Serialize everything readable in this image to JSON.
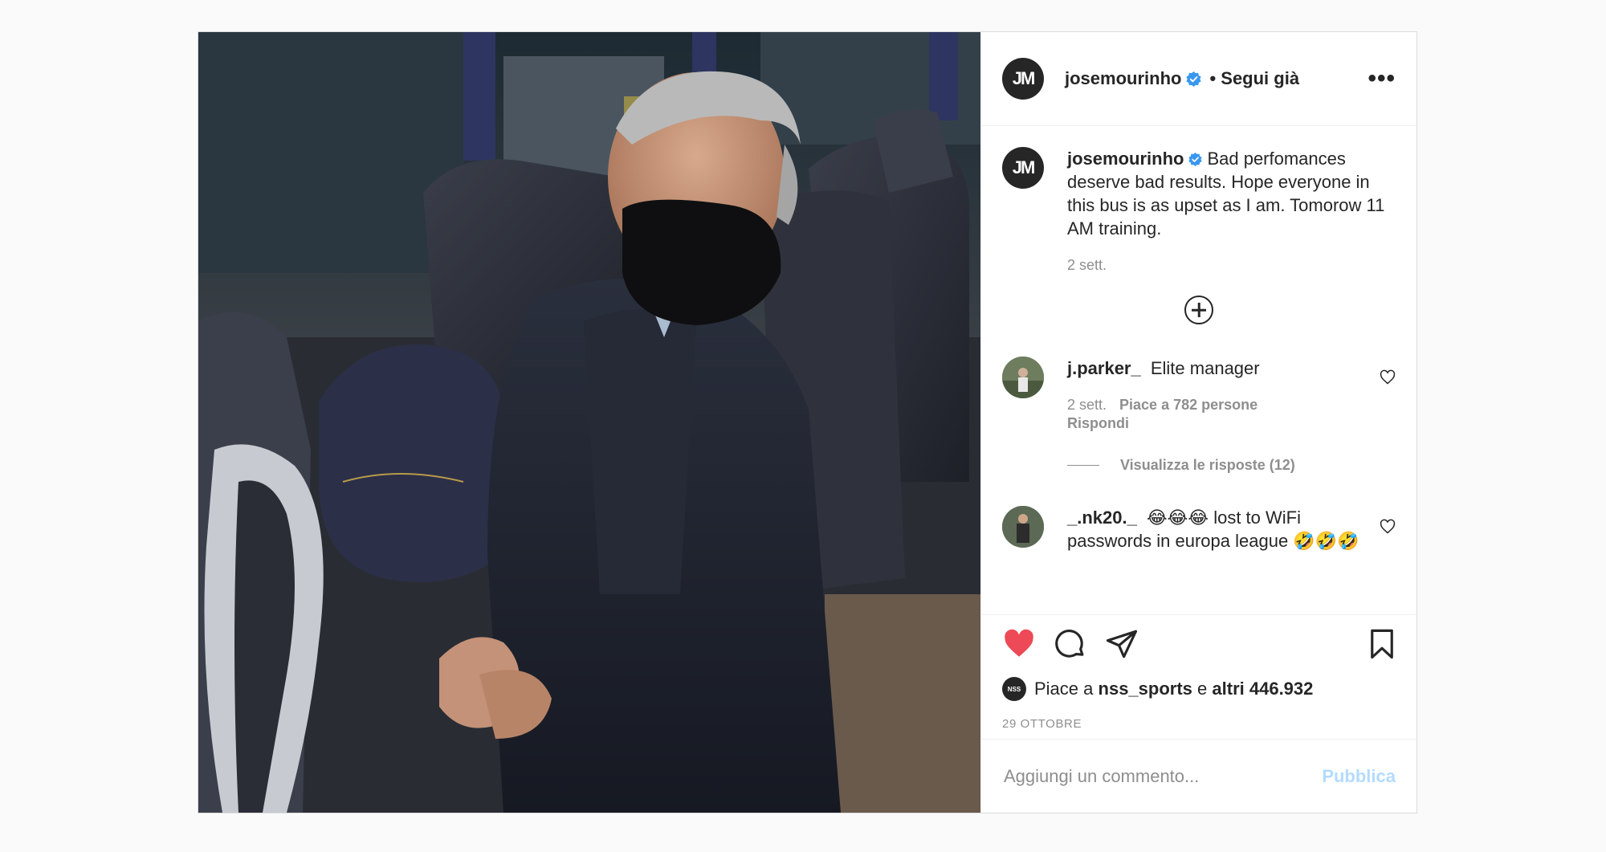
{
  "post": {
    "username": "josemourinho",
    "follow_status": "• Segui già",
    "more_label": "•••",
    "avatar_mark": "JM",
    "image_alt": "Man wearing a black face mask seated on a bus",
    "caption": {
      "username": "josemourinho",
      "text": "Bad perfomances deserve bad results. Hope everyone in this bus is as upset as I am. Tomorow 11 AM training.",
      "time": "2 sett."
    },
    "comments": [
      {
        "username": "j.parker_",
        "text": "Elite manager",
        "time": "2 sett.",
        "likes": "Piace a 782 persone",
        "reply": "Rispondi",
        "view_replies": "Visualizza le risposte (12)"
      },
      {
        "username": "_.nk20._",
        "text": "😂😂😂 lost to WiFi passwords in europa league 🤣🤣🤣"
      }
    ],
    "liked_by": {
      "prefix": "Piace a",
      "user": "nss_sports",
      "mid": "e",
      "others": "altri 446.932",
      "avatar_mark": "NSS"
    },
    "date": "29 OTTOBRE",
    "add_comment_placeholder": "Aggiungi un commento...",
    "publish_label": "Pubblica",
    "icons": {
      "like": "heart-filled-icon",
      "comment": "comment-icon",
      "share": "paper-plane-icon",
      "save": "bookmark-icon",
      "load_more": "plus-circle-icon",
      "verified": "verified-badge-icon"
    },
    "colors": {
      "like_red": "#ed4956",
      "verified_blue": "#3897f0",
      "publish_disabled": "#b3dbff",
      "secondary_text": "#8e8e8e"
    }
  }
}
